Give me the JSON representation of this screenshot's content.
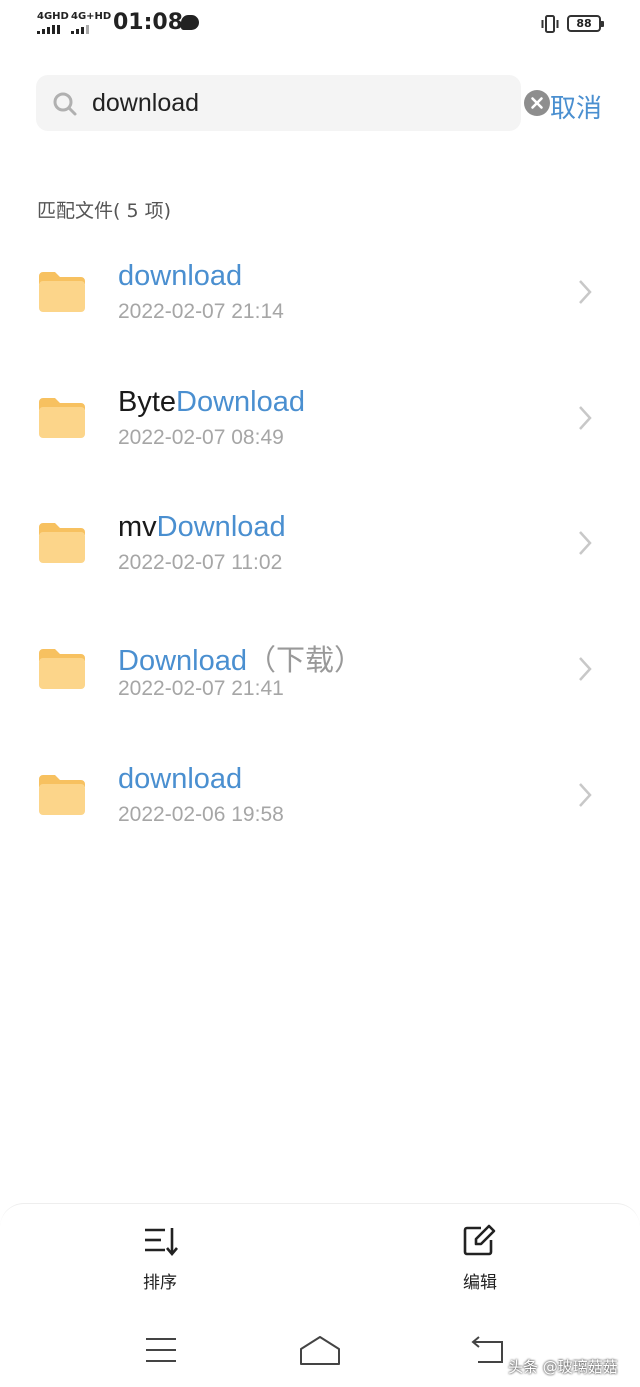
{
  "status_bar": {
    "sim1": "4GHD",
    "sim2": "4G+HD",
    "time": "01:08",
    "battery": "88"
  },
  "search": {
    "value": "download",
    "cancel_label": "取消"
  },
  "results": {
    "count_label": "匹配文件( 5 项)",
    "items": [
      {
        "prefix": "",
        "match": "download",
        "suffix": "",
        "date": "2022-02-07 21:14"
      },
      {
        "prefix": "Byte",
        "match": "Download",
        "suffix": "",
        "date": "2022-02-07 08:49"
      },
      {
        "prefix": "mv",
        "match": "Download",
        "suffix": "",
        "date": "2022-02-07 11:02"
      },
      {
        "prefix": "",
        "match": "Download",
        "suffix": "（下载）",
        "date": "2022-02-07 21:41"
      },
      {
        "prefix": "",
        "match": "download",
        "suffix": "",
        "date": "2022-02-06 19:58"
      }
    ]
  },
  "toolbar": {
    "sort_label": "排序",
    "edit_label": "编辑"
  },
  "watermark": "头条 @玻璃菇菇",
  "colors": {
    "accent": "#4a8fd0",
    "folder": "#fcd58a",
    "folder_tab": "#f7c160"
  }
}
